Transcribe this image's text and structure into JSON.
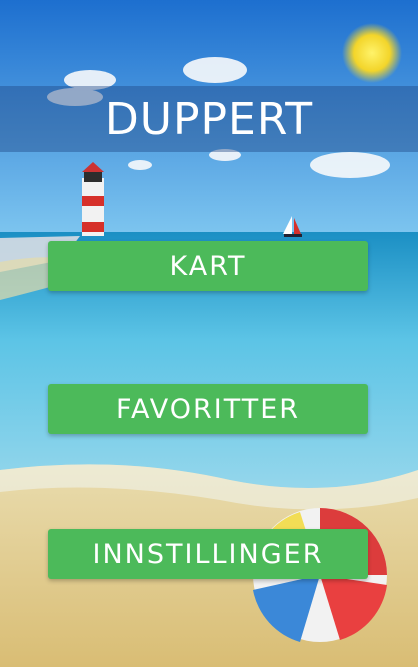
{
  "app": {
    "title": "DUPPERT"
  },
  "menu": {
    "buttons": [
      {
        "label": "KART"
      },
      {
        "label": "FAVORITTER"
      },
      {
        "label": "INNSTILLINGER"
      }
    ]
  },
  "colors": {
    "button_bg": "#4cba5a",
    "title_band": "#1e4682",
    "sky": "#2f7fcf",
    "sea": "#5cc0e2",
    "sand": "#e6d49c"
  },
  "icons": [
    "sun-icon",
    "lighthouse-icon",
    "sailboat-icon",
    "beach-ball-icon"
  ]
}
